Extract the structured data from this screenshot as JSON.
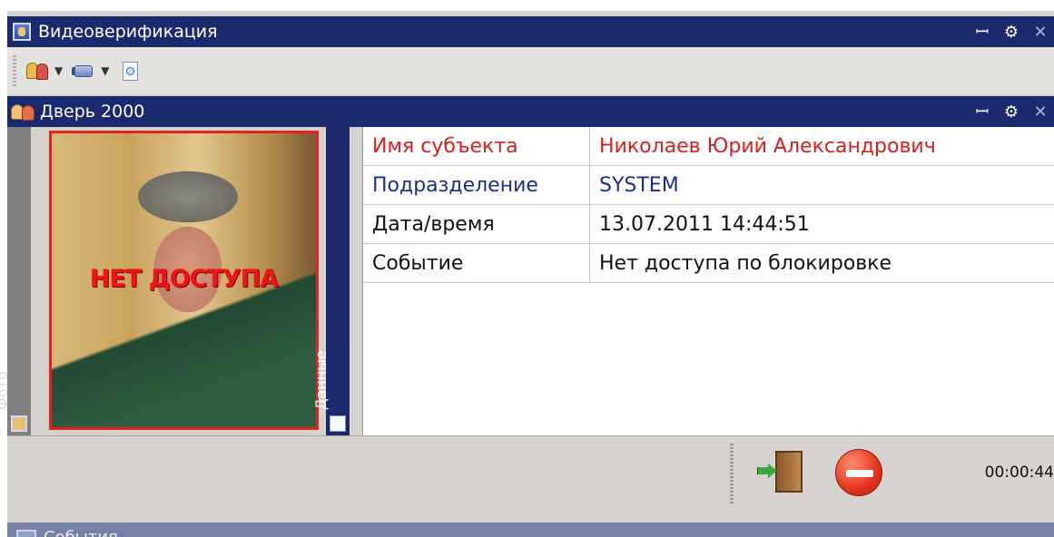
{
  "window": {
    "title": "Видеоверификация",
    "controls": {
      "pin": "ꟷ",
      "gear": "⚙",
      "close": "✕"
    }
  },
  "toolbar": {
    "items": [
      {
        "icon": "users-icon",
        "has_dropdown": true
      },
      {
        "icon": "camera-icon",
        "has_dropdown": true
      },
      {
        "icon": "info-document-icon",
        "has_dropdown": false
      }
    ]
  },
  "door_panel": {
    "title": "Дверь 2000",
    "tabs": {
      "photo": "Фото",
      "data": "Данные"
    },
    "photo_stamp": "НЕТ ДОСТУПА",
    "details": [
      {
        "key": "Имя субъекта",
        "value": "Николаев Юрий Александрович",
        "color": "#d42020"
      },
      {
        "key": "Подразделение",
        "value": "SYSTEM",
        "color": "#1c2d92"
      },
      {
        "key": "Дата/время",
        "value": "13.07.2011 14:44:51",
        "color": "#111111"
      },
      {
        "key": "Событие",
        "value": "Нет доступа по блокировке",
        "color": "#111111"
      }
    ]
  },
  "actions": {
    "open_door_icon": "door-enter-icon",
    "deny_icon": "no-entry-icon",
    "timer": "00:00:44"
  },
  "next_panel": {
    "title": "События"
  },
  "colors": {
    "titlebar": "#1b2a6e",
    "stamp": "#ee1515",
    "photo_border": "#e52222"
  }
}
